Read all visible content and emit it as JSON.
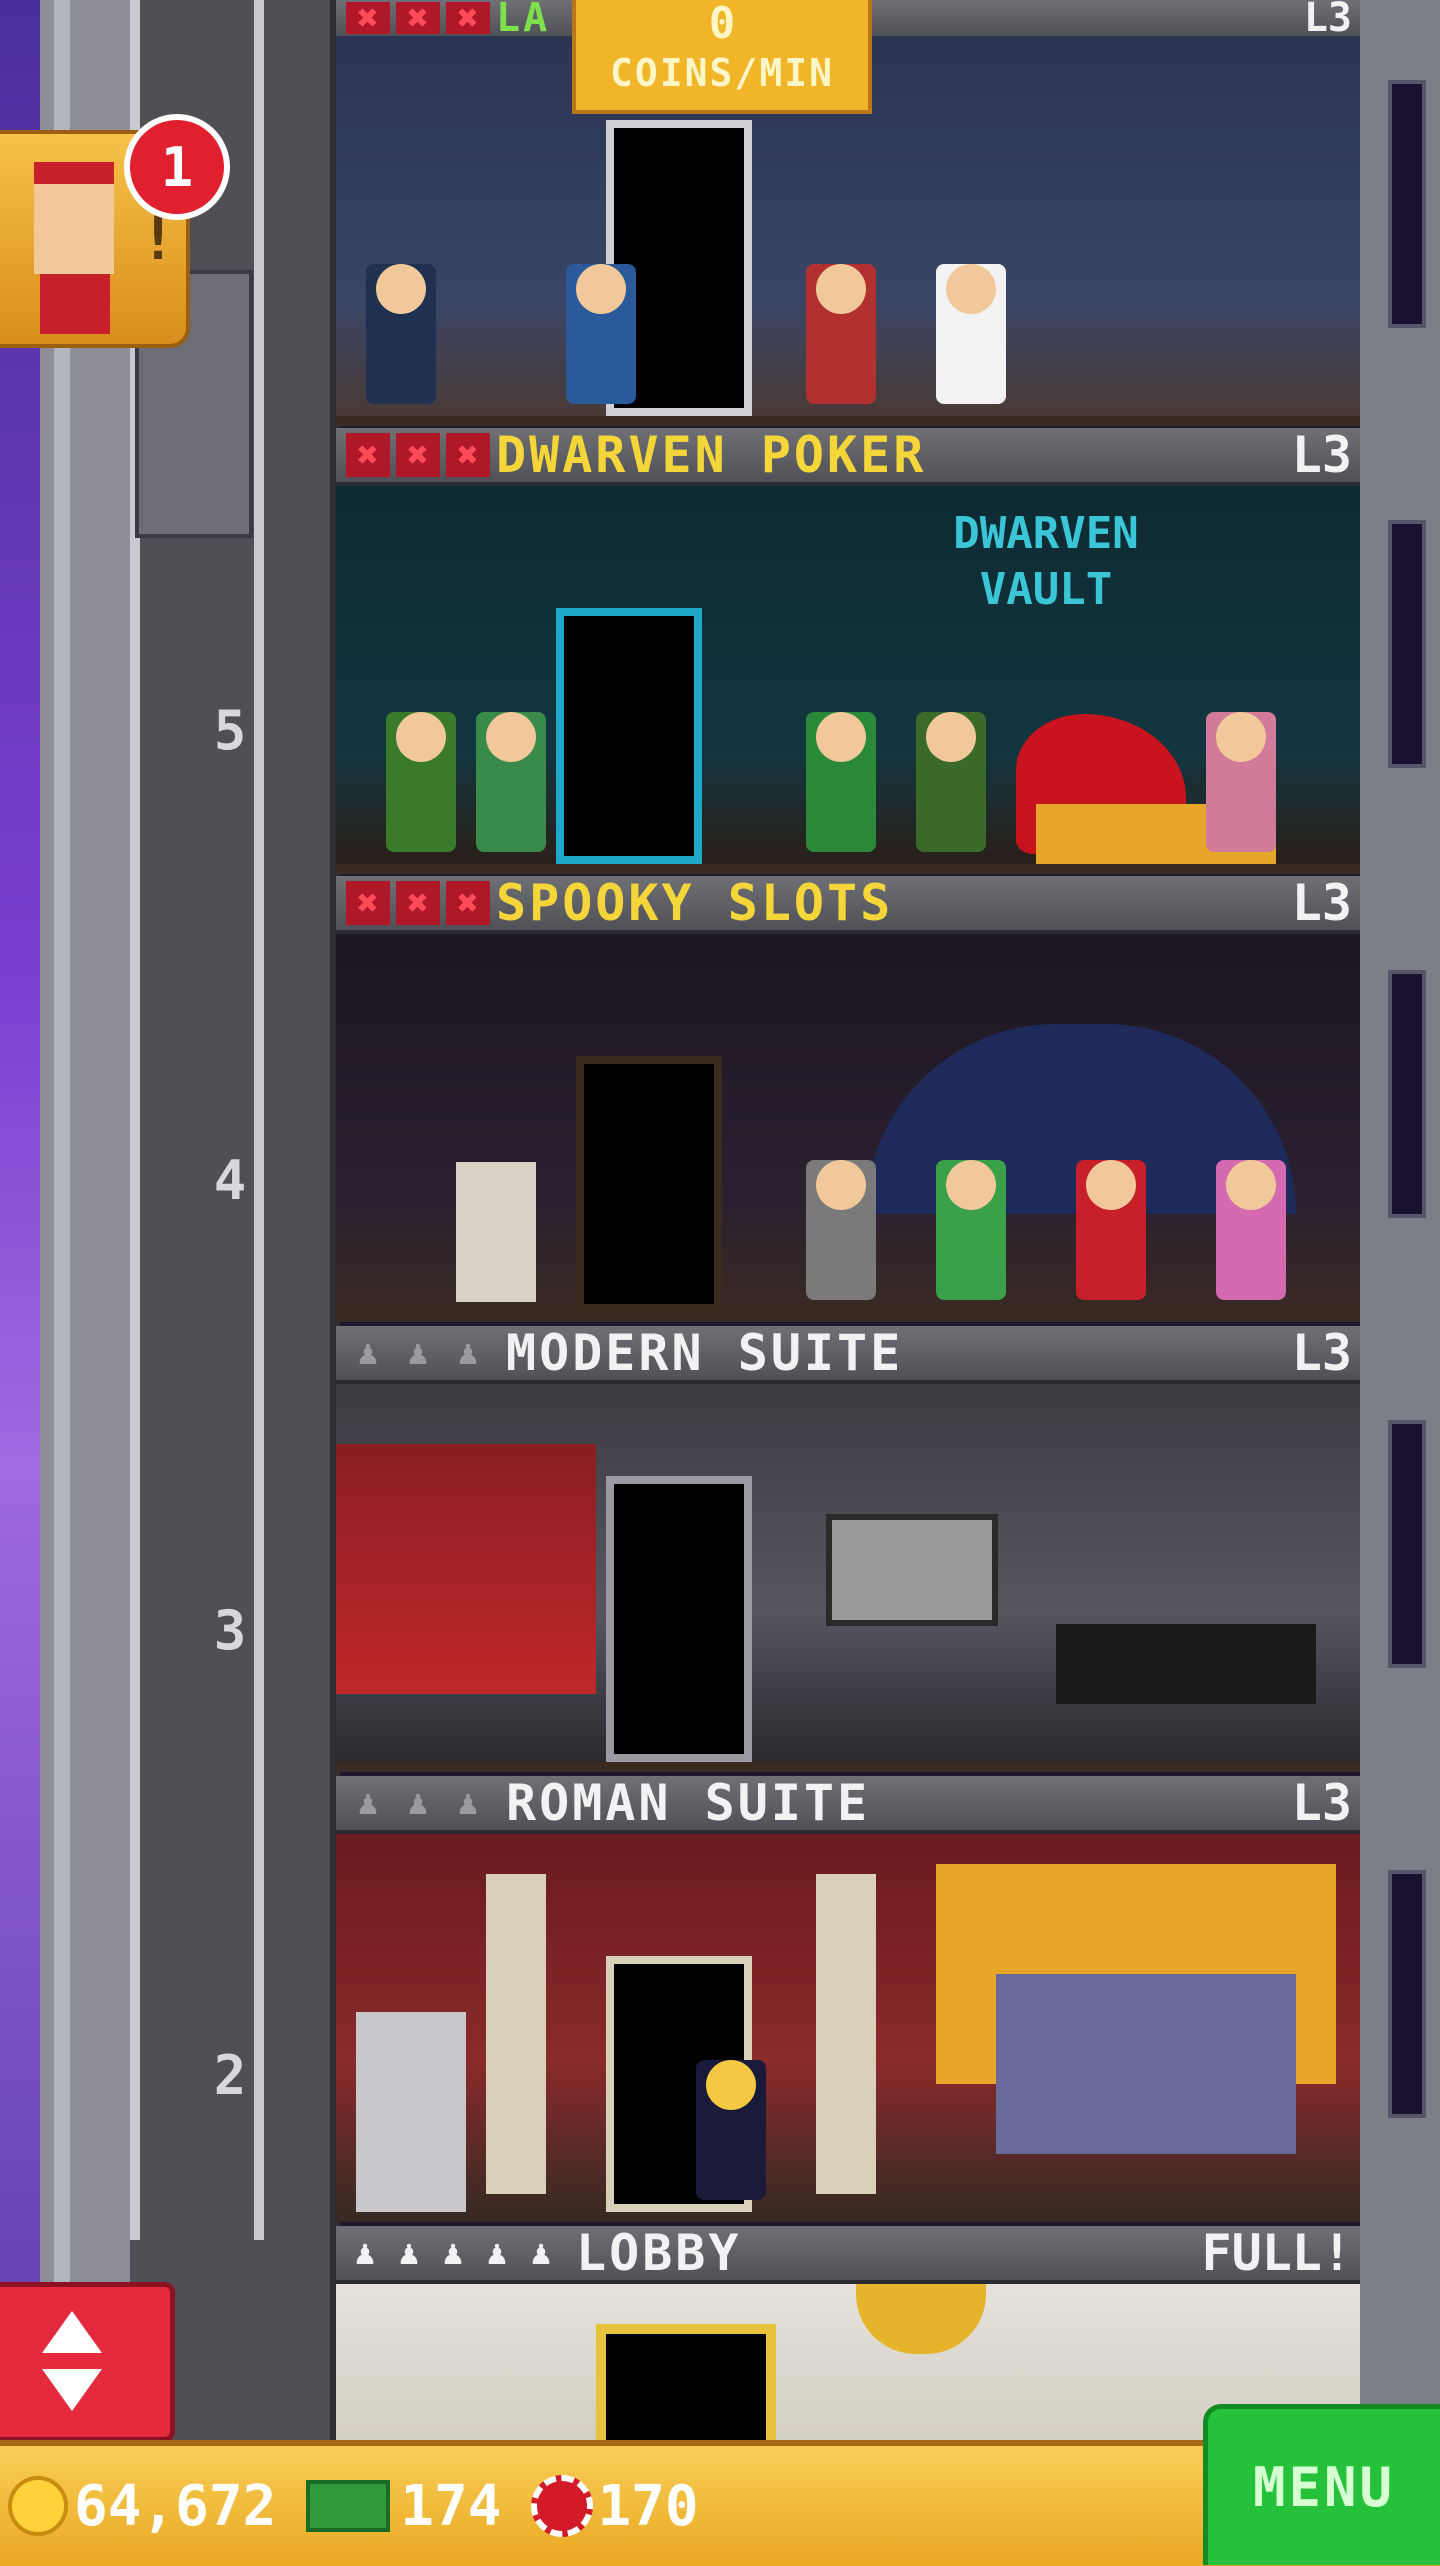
{
  "top_floor": {
    "stars": [
      "x",
      "x",
      "x"
    ],
    "name": "LA",
    "level": "L3",
    "coin_rate": {
      "value": "0",
      "label": "COINS/MIN"
    }
  },
  "floors": [
    {
      "name": "DWARVEN POKER",
      "level": "L3",
      "star_style": "red",
      "sign": "DWARVEN VAULT"
    },
    {
      "name": "SPOOKY SLOTS",
      "level": "L3",
      "star_style": "red"
    },
    {
      "name": "MODERN SUITE",
      "level": "L3",
      "star_style": "grey"
    },
    {
      "name": "ROMAN SUITE",
      "level": "L3",
      "star_style": "grey"
    },
    {
      "name": "LOBBY",
      "level": "FULL!",
      "star_style": "grey"
    }
  ],
  "shaft_floor_numbers": [
    "5",
    "4",
    "3",
    "2"
  ],
  "bellhop_notification": {
    "count": "1",
    "icon": "exclamation-icon"
  },
  "currency": {
    "coins": "64,672",
    "bux": "174",
    "chips": "170"
  },
  "menu_label": "MENU",
  "colors": {
    "brand_yellow": "#f5d63a",
    "menu_green": "#26c13b",
    "alert_red": "#e0202e",
    "bar_gold": "#f1b52a"
  }
}
